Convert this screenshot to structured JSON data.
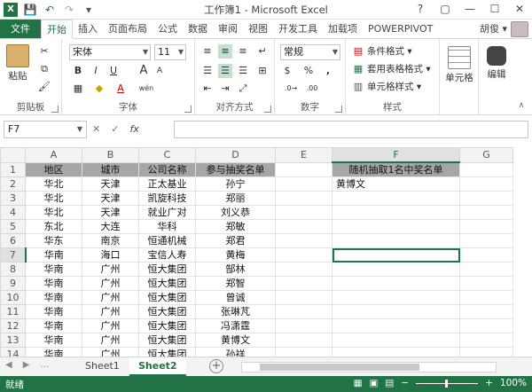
{
  "window": {
    "title": "工作簿1 - Microsoft Excel",
    "controls": [
      "?",
      "▢",
      "—",
      "☐",
      "✕"
    ]
  },
  "qat": {
    "save": "💾",
    "undo": "↶",
    "redo": "↷",
    "customize": "▾"
  },
  "tabs": {
    "file": "文件",
    "items": [
      "开始",
      "插入",
      "页面布局",
      "公式",
      "数据",
      "审阅",
      "视图",
      "开发工具",
      "加载项",
      "POWERPIVOT"
    ],
    "active_index": 0,
    "user": "胡俊 ▾"
  },
  "ribbon": {
    "clipboard": {
      "label": "剪贴板",
      "paste": "粘贴"
    },
    "font": {
      "label": "字体",
      "name": "宋体",
      "size": "11",
      "bold": "B",
      "italic": "I",
      "underline": "U",
      "grow": "A",
      "shrink": "A",
      "font_color": "A",
      "phonetic": "wén"
    },
    "alignment": {
      "label": "对齐方式"
    },
    "number": {
      "label": "数字",
      "format": "常规",
      "currency": "$",
      "percent": "%",
      "comma": ","
    },
    "styles": {
      "label": "样式",
      "conditional": "条件格式 ▾",
      "table": "套用表格格式 ▾",
      "cell": "单元格样式 ▾"
    },
    "cells": {
      "label": "单元格"
    },
    "editing": {
      "label": "编辑"
    }
  },
  "formula_bar": {
    "name_box": "F7",
    "cancel": "✕",
    "enter": "✓",
    "fx": "fx",
    "value": ""
  },
  "columns": [
    "A",
    "B",
    "C",
    "D",
    "E",
    "F",
    "G"
  ],
  "rows": [
    [
      "地区",
      "城市",
      "公司名称",
      "参与抽奖名单",
      "",
      "随机抽取1名中奖名单",
      ""
    ],
    [
      "华北",
      "天津",
      "正太基业",
      "孙宁",
      "",
      "黄博文",
      ""
    ],
    [
      "华北",
      "天津",
      "凯旋科技",
      "郑丽",
      "",
      "",
      ""
    ],
    [
      "华北",
      "天津",
      "就业广对",
      "刘义恭",
      "",
      "",
      ""
    ],
    [
      "东北",
      "大连",
      "华科",
      "郑敏",
      "",
      "",
      ""
    ],
    [
      "华东",
      "南京",
      "恒通机械",
      "郑君",
      "",
      "",
      ""
    ],
    [
      "华南",
      "海口",
      "宝信人寿",
      "黄梅",
      "",
      "",
      ""
    ],
    [
      "华南",
      "广州",
      "恒大集团",
      "郜林",
      "",
      "",
      ""
    ],
    [
      "华南",
      "广州",
      "恒大集团",
      "郑智",
      "",
      "",
      ""
    ],
    [
      "华南",
      "广州",
      "恒大集团",
      "曾诚",
      "",
      "",
      ""
    ],
    [
      "华南",
      "广州",
      "恒大集团",
      "张琳芃",
      "",
      "",
      ""
    ],
    [
      "华南",
      "广州",
      "恒大集团",
      "冯潇霆",
      "",
      "",
      ""
    ],
    [
      "华南",
      "广州",
      "恒大集团",
      "黄博文",
      "",
      "",
      ""
    ],
    [
      "华南",
      "广州",
      "恒大集团",
      "孙祥",
      "",
      "",
      ""
    ]
  ],
  "sheets": {
    "items": [
      "Sheet1",
      "Sheet2"
    ],
    "active_index": 1,
    "add": "+"
  },
  "status": {
    "left": "就绪",
    "zoom": "100%",
    "minus": "−",
    "plus": "+"
  },
  "colors": {
    "accent": "#217346",
    "header_fill": "#a6a6a6"
  }
}
